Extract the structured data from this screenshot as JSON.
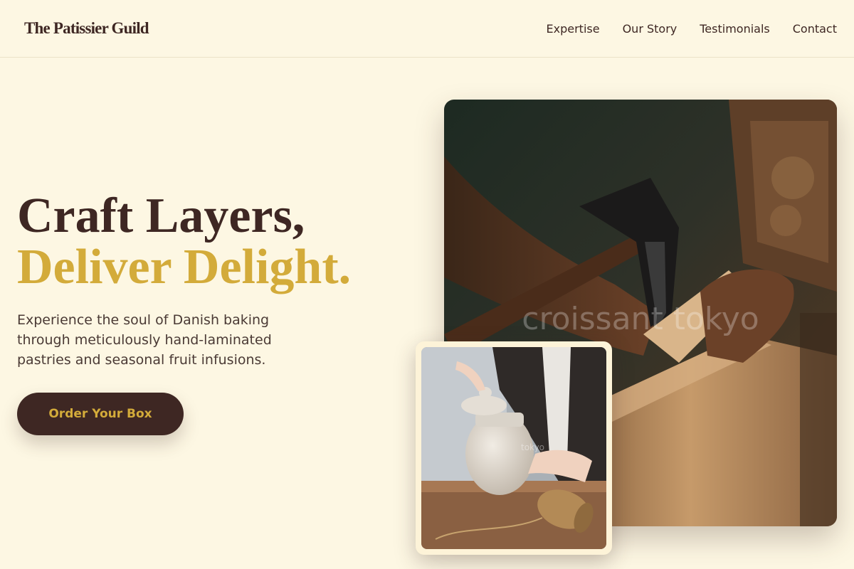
{
  "brand": {
    "name": "The Patissier Guild"
  },
  "nav": {
    "items": [
      {
        "label": "Expertise"
      },
      {
        "label": "Our Story"
      },
      {
        "label": "Testimonials"
      },
      {
        "label": "Contact"
      }
    ]
  },
  "hero": {
    "title_line1": "Craft Layers,",
    "title_line2": "Deliver Delight.",
    "description": "Experience the soul of Danish baking through meticulously hand-laminated pastries and seasonal fruit infusions.",
    "cta_label": "Order Your Box"
  },
  "images": {
    "main_watermark": "croissant tokyo",
    "inset_watermark": "tokyo"
  },
  "colors": {
    "background": "#fdf7e3",
    "dark_brown": "#3e2723",
    "gold": "#d3ab3a"
  }
}
